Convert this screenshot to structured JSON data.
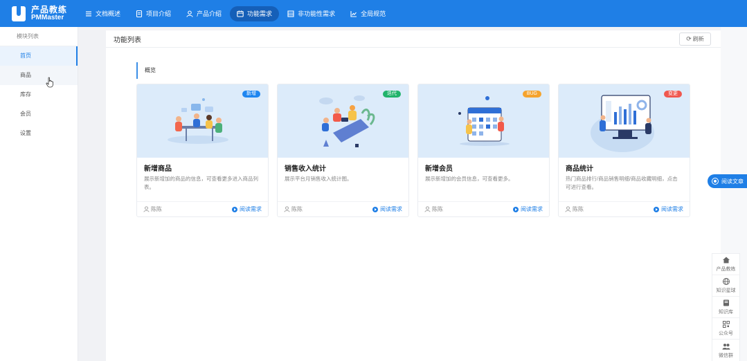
{
  "logo": {
    "cn": "产品教练",
    "en": "PMMaster"
  },
  "nav": [
    {
      "label": "文档概述",
      "icon": "list-icon"
    },
    {
      "label": "项目介绍",
      "icon": "document-icon"
    },
    {
      "label": "产品介绍",
      "icon": "user-icon"
    },
    {
      "label": "功能需求",
      "icon": "calendar-icon",
      "active": true
    },
    {
      "label": "非功能性需求",
      "icon": "grid-icon"
    },
    {
      "label": "全局规范",
      "icon": "chart-icon"
    }
  ],
  "sidebar": {
    "title": "模块列表",
    "items": [
      {
        "label": "首页"
      },
      {
        "label": "商品"
      },
      {
        "label": "库存"
      },
      {
        "label": "会员"
      },
      {
        "label": "设置"
      }
    ]
  },
  "main": {
    "title": "功能列表",
    "refresh_label": "刷新",
    "section_label": "概览",
    "cards": [
      {
        "title": "新增商品",
        "badge": "新增",
        "badge_color": "#1f86f0",
        "desc": "展示新增加的商品的信息，可查看更多进入商品列表。",
        "author": "陈陈",
        "read": "阅读需求"
      },
      {
        "title": "销售收入统计",
        "badge": "迭代",
        "badge_color": "#21b36b",
        "desc": "展示平台月销售收入统计图。",
        "author": "陈陈",
        "read": "阅读需求"
      },
      {
        "title": "新增会员",
        "badge": "BUG",
        "badge_color": "#f5a32d",
        "desc": "展示新增加的会员信息，可查看更多。",
        "author": "陈陈",
        "read": "阅读需求"
      },
      {
        "title": "商品统计",
        "badge": "变更",
        "badge_color": "#f0584f",
        "desc": "热门商品排行/商品销售明细/商品收藏明细，点击可进行查看。",
        "author": "陈陈",
        "read": "阅读需求"
      }
    ]
  },
  "read_article": "阅读文章",
  "tools": [
    {
      "label": "产品教练",
      "icon": "home-icon"
    },
    {
      "label": "知识星球",
      "icon": "globe-icon"
    },
    {
      "label": "知识库",
      "icon": "book-icon"
    },
    {
      "label": "公众号",
      "icon": "qrcode-icon"
    },
    {
      "label": "微信群",
      "icon": "group-icon"
    }
  ]
}
